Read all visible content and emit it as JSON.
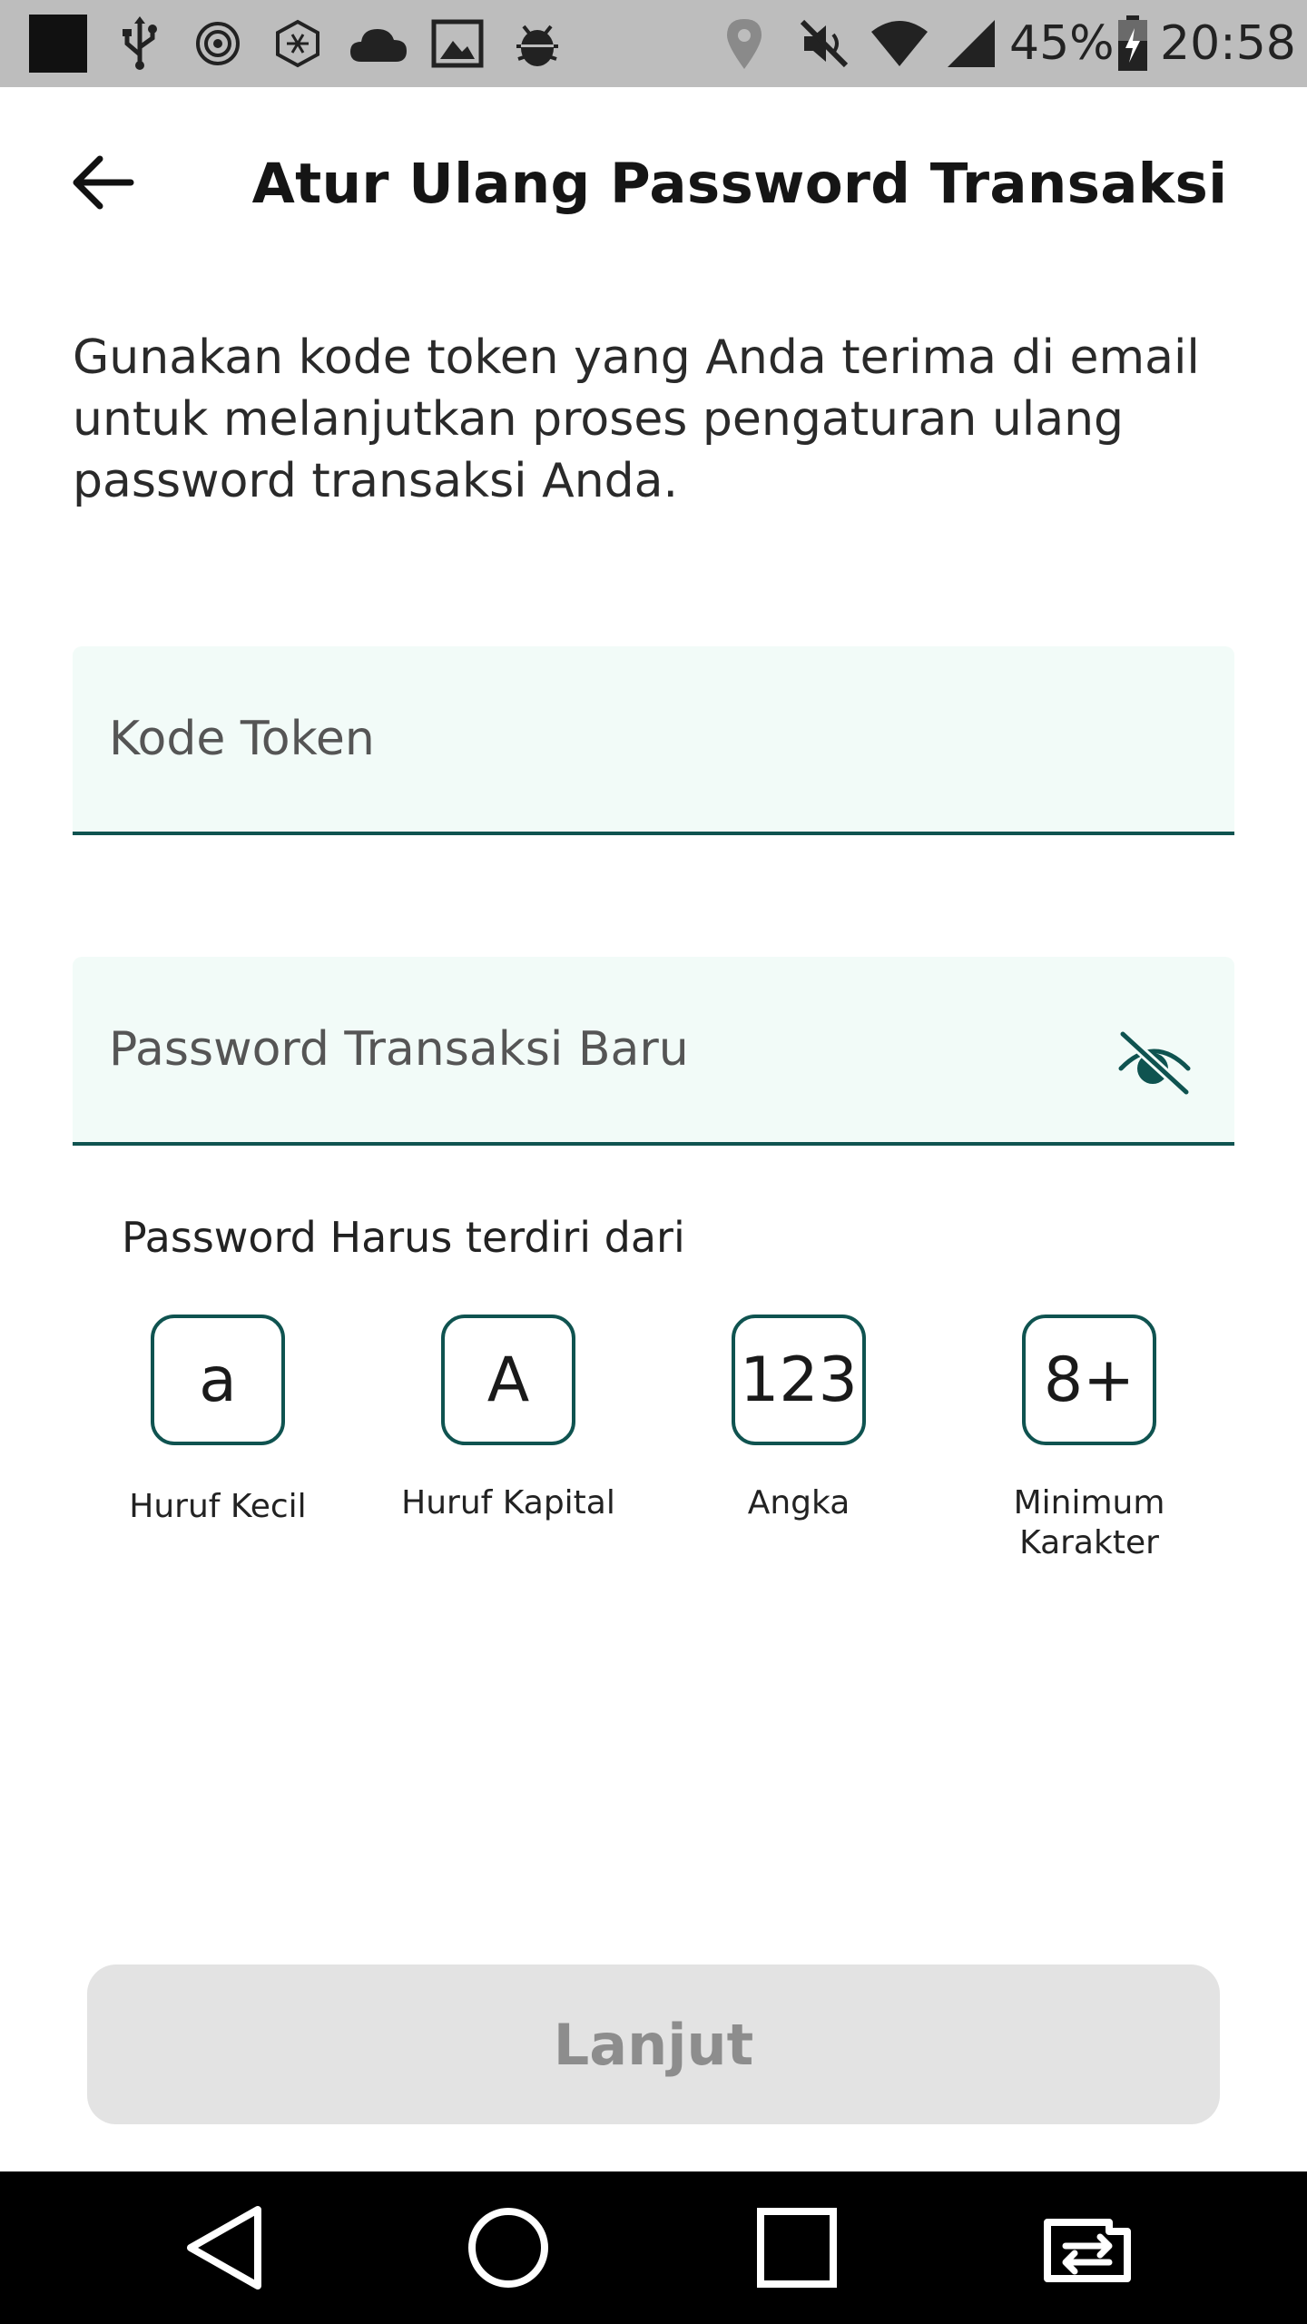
{
  "status_bar": {
    "battery_percent": "45%",
    "time": "20:58",
    "icons": [
      "app-notification-icon",
      "usb-icon",
      "settings-app-icon",
      "hexagon-app-icon",
      "cloud-icon",
      "image-icon",
      "android-debug-icon",
      "location-icon",
      "mute-icon",
      "wifi-icon",
      "signal-icon",
      "battery-charging-icon"
    ]
  },
  "header": {
    "title": "Atur Ulang Password Transaksi",
    "back_icon": "arrow-left-icon"
  },
  "description": "Gunakan kode token yang Anda terima di email untuk melanjutkan proses pengaturan ulang password transaksi Anda.",
  "form": {
    "token_placeholder": "Kode Token",
    "token_value": "",
    "password_placeholder": "Password Transaksi Baru",
    "password_value": "",
    "visibility_icon": "eye-off-icon"
  },
  "requirements": {
    "title": "Password Harus terdiri dari",
    "items": [
      {
        "symbol": "a",
        "label": "Huruf Kecil"
      },
      {
        "symbol": "A",
        "label": "Huruf Kapital"
      },
      {
        "symbol": "123",
        "label": "Angka"
      },
      {
        "symbol": "8+",
        "label": "Minimum Karakter"
      }
    ]
  },
  "continue_button": {
    "label": "Lanjut",
    "enabled": false
  },
  "nav_bar": {
    "icons": [
      "nav-back-icon",
      "nav-home-icon",
      "nav-recents-icon",
      "nav-switch-icon"
    ]
  },
  "colors": {
    "accent": "#0f5350",
    "field_background": "#f2fbf8",
    "button_disabled_bg": "#e3e3e3",
    "button_disabled_text": "#8d8d8d",
    "status_bar": "#bdbdbd",
    "nav_bar": "#000000"
  }
}
